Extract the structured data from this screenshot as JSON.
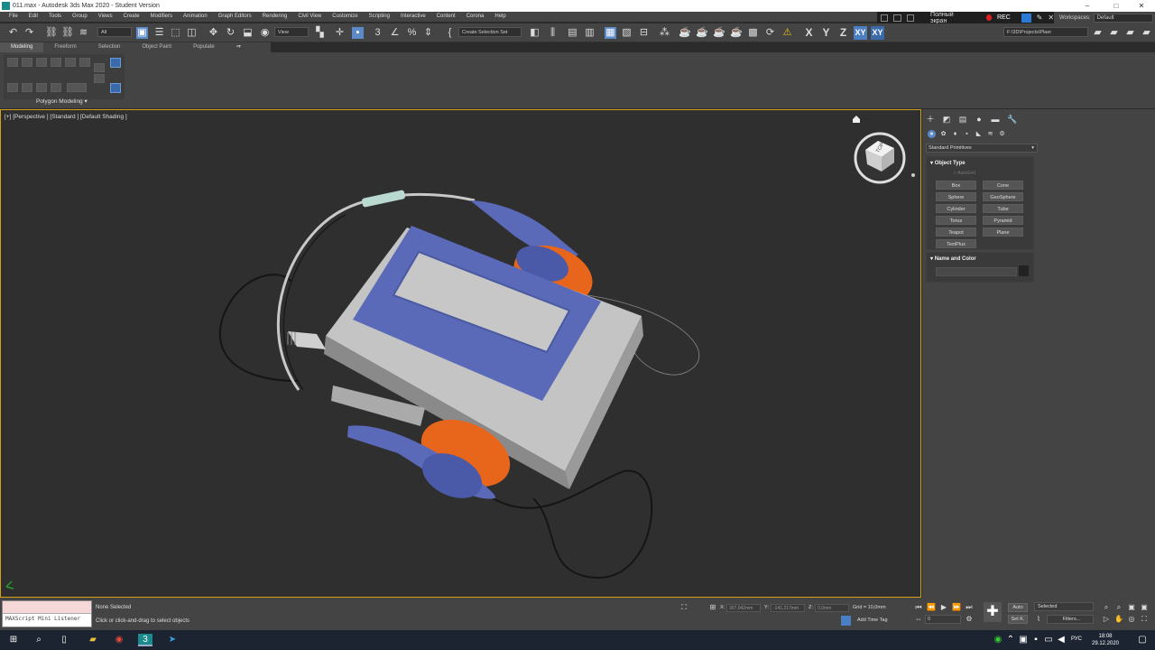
{
  "window": {
    "title": "011.max - Autodesk 3ds Max 2020 - Student Version"
  },
  "menu": [
    "File",
    "Edit",
    "Tools",
    "Group",
    "Views",
    "Create",
    "Modifiers",
    "Animation",
    "Graph Editors",
    "Rendering",
    "Civil View",
    "Customize",
    "Scripting",
    "Interactive",
    "Content",
    "Corona",
    "Help"
  ],
  "recorder": {
    "fullscreen": "Полный экран",
    "rec": "REC"
  },
  "workspace": {
    "label": "Workspaces:",
    "value": "Default"
  },
  "toolbar": {
    "filter": "All",
    "view": "View",
    "selection_set": "Create Selection Set",
    "project_path": "F:\\3D\\Projects\\Plaer",
    "axes": [
      "X",
      "Y",
      "Z",
      "XY",
      "XY"
    ]
  },
  "ribbon": {
    "tabs": [
      "Modeling",
      "Freeform",
      "Selection",
      "Object Paint",
      "Populate"
    ],
    "panel_label": "Polygon Modeling ▾"
  },
  "viewport": {
    "label": "[+] [Perspective ] [Standard ] [Default Shading ]",
    "viewcube_face": "TOP"
  },
  "command_panel": {
    "primitive_type": "Standard Primitives",
    "object_type": {
      "header": "Object Type",
      "autogrid": "AutoGrid",
      "buttons": [
        "Box",
        "Cone",
        "Sphere",
        "GeoSphere",
        "Cylinder",
        "Tube",
        "Torus",
        "Pyramid",
        "Teapot",
        "Plane",
        "TextPlus"
      ]
    },
    "name_color": {
      "header": "Name and Color"
    }
  },
  "statusbar": {
    "maxscript": "MAXScript Mini Listener",
    "selection": "None Selected",
    "prompt": "Click or click-and-drag to select objects",
    "x_label": "X:",
    "x_value": "307,042mm",
    "y_label": "Y:",
    "y_value": "-141,217mm",
    "z_label": "Z:",
    "z_value": "0,0mm",
    "grid": "Grid = 10,0mm",
    "add_time_tag": "Add Time Tag",
    "frame": "0",
    "auto": "Auto",
    "set_k": "Set K.",
    "selected": "Selected",
    "filters": "Filters..."
  },
  "taskbar": {
    "lang": "РУС",
    "time": "18:08",
    "date": "29.12.2020"
  },
  "colors": {
    "accent": "#5a8ac8",
    "viewport_border": "#d4a017",
    "player_blue": "#5a6ab8",
    "player_gray": "#c4c4c4",
    "earpad_orange": "#e8661c"
  }
}
